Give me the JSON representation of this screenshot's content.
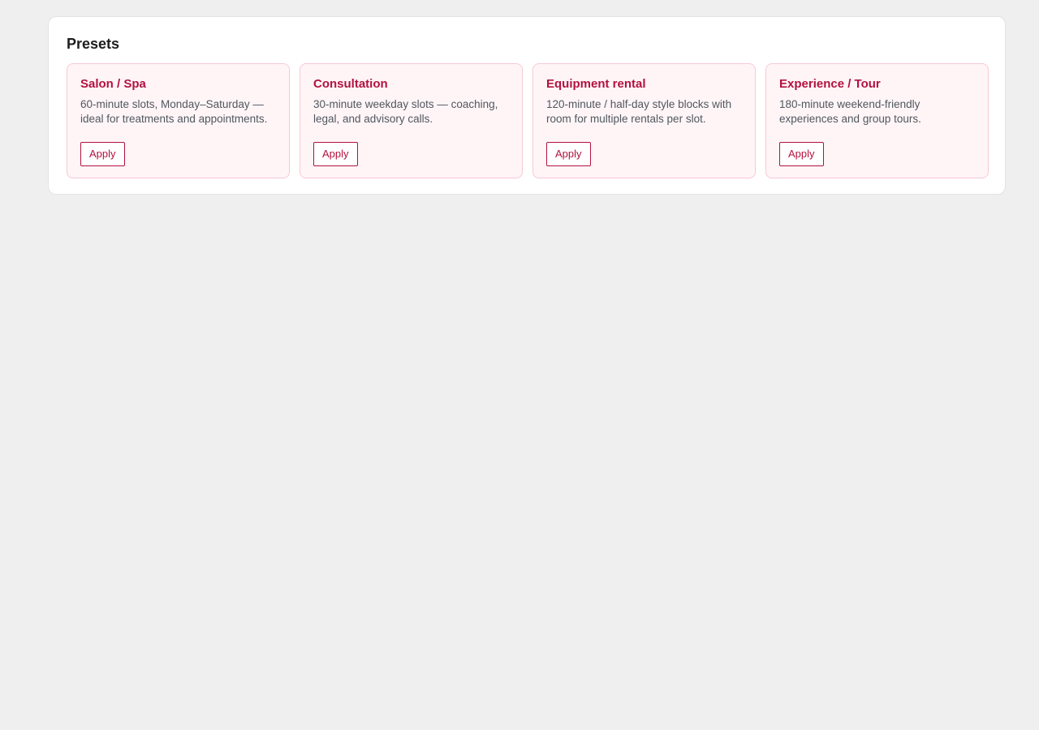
{
  "panel": {
    "title": "Presets"
  },
  "presets": [
    {
      "title": "Salon / Spa",
      "description": "60-minute slots, Monday–Saturday — ideal for treatments and appointments.",
      "button_label": "Apply"
    },
    {
      "title": "Consultation",
      "description": "30-minute weekday slots — coaching, legal, and advisory calls.",
      "button_label": "Apply"
    },
    {
      "title": "Equipment rental",
      "description": "120-minute / half-day style blocks with room for multiple rentals per slot.",
      "button_label": "Apply"
    },
    {
      "title": "Experience / Tour",
      "description": "180-minute weekend-friendly experiences and group tours.",
      "button_label": "Apply"
    }
  ],
  "colors": {
    "accent": "#b3123f",
    "card_background": "#fff5f7",
    "card_border": "#f6c9d5",
    "page_background": "#efefef"
  }
}
